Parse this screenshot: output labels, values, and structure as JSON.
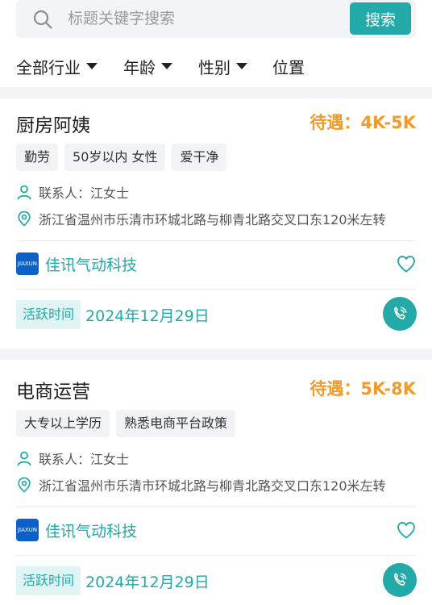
{
  "colors": {
    "accent": "#22a9a8",
    "salary": "#f29b2c",
    "active_label_bg": "#dff4f3",
    "company_logo_bg": "#0b61c8"
  },
  "search": {
    "placeholder": "标题关键字搜索",
    "button_label": "搜索",
    "icon": "search-icon"
  },
  "filters": [
    {
      "label": "全部行业",
      "has_dropdown": true
    },
    {
      "label": "年龄",
      "has_dropdown": true
    },
    {
      "label": "性别",
      "has_dropdown": true
    },
    {
      "label": "位置",
      "has_dropdown": false
    }
  ],
  "jobs": [
    {
      "title": "厨房阿姨",
      "salary": "待遇：4K-5K",
      "tags": [
        "勤劳",
        "50岁以内 女性",
        "爱干净"
      ],
      "contact": "联系人：江女士",
      "address": "浙江省温州市乐清市环城北路与柳青北路交叉口东120米左转",
      "company_logo_text": "JIAXUN",
      "company": "佳讯气动科技",
      "active_label": "活跃时间",
      "active_date": "2024年12月29日"
    },
    {
      "title": "电商运营",
      "salary": "待遇：5K-8K",
      "tags": [
        "大专以上学历",
        "熟悉电商平台政策"
      ],
      "contact": "联系人：江女士",
      "address": "浙江省温州市乐清市环城北路与柳青北路交叉口东120米左转",
      "company_logo_text": "JIAXUN",
      "company": "佳讯气动科技",
      "active_label": "活跃时间",
      "active_date": "2024年12月29日"
    }
  ]
}
